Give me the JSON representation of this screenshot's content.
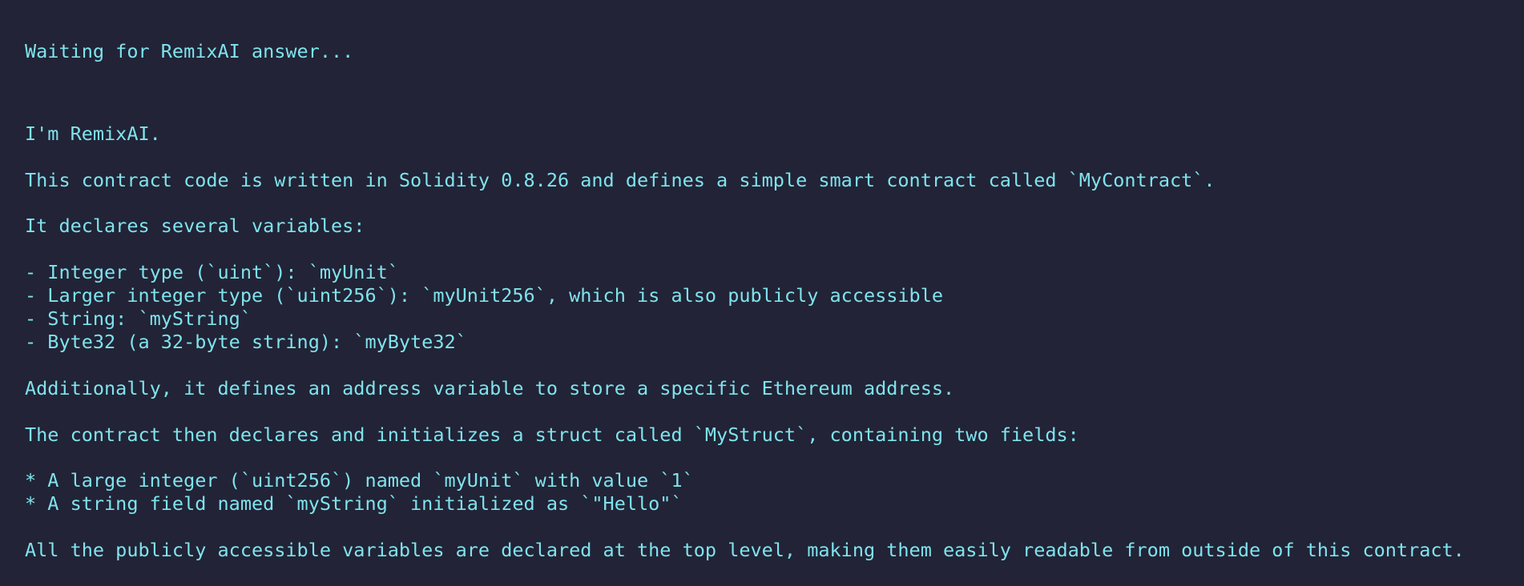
{
  "status": {
    "waiting_text": "Waiting for RemixAI answer..."
  },
  "answer": {
    "intro": "I'm RemixAI.",
    "summary": "This contract code is written in Solidity 0.8.26 and defines a simple smart contract called `MyContract`.",
    "variables_heading": "It declares several variables:",
    "variables": [
      "- Integer type (`uint`): `myUnit`",
      "- Larger integer type (`uint256`): `myUnit256`, which is also publicly accessible",
      "- String: `myString`",
      "- Byte32 (a 32-byte string): `myByte32`"
    ],
    "address_note": "Additionally, it defines an address variable to store a specific Ethereum address.",
    "struct_heading": "The contract then declares and initializes a struct called `MyStruct`, containing two fields:",
    "struct_fields": [
      "* A large integer (`uint256`) named `myUnit` with value `1`",
      "* A string field named `myString` initialized as `\"Hello\"`"
    ],
    "conclusion": "All the publicly accessible variables are declared at the top level, making them easily readable from outside of this contract."
  },
  "colors": {
    "background": "#222336",
    "text": "#7fe3ed"
  }
}
